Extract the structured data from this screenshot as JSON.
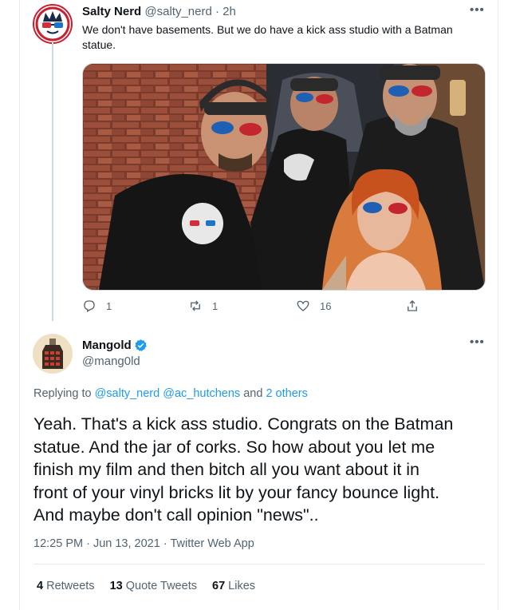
{
  "tweet1": {
    "display_name": "Salty Nerd",
    "handle": "@salty_nerd",
    "separator": "·",
    "time": "2h",
    "text_line1": "We don't have basements. But we do have a kick ass studio with a Batman",
    "text_line2": "statue.",
    "replies": "1",
    "retweets": "1",
    "likes": "16"
  },
  "tweet2": {
    "display_name": "Mangold",
    "handle": "@mang0ld",
    "replying_prefix": "Replying to",
    "replying_users": "@salty_nerd @ac_hutchens",
    "replying_and": "and",
    "replying_others": "2 others",
    "body_lines": [
      "Yeah. That's a kick ass studio. Congrats on the Batman",
      "statue. And the jar of corks. So how about you let me",
      "finish my film and then bitch all you want about it in",
      "front of your vinyl bricks lit by your fancy bounce light.",
      "And maybe don't call opinion \"news\".."
    ],
    "timestamp": "12:25 PM · Jun 13, 2021",
    "source_sep": "·",
    "source": "Twitter Web App",
    "stats": {
      "retweets_num": "4",
      "retweets_label": "Retweets",
      "quotes_num": "13",
      "quotes_label": "Quote Tweets",
      "likes_num": "67",
      "likes_label": "Likes"
    }
  },
  "more_icon": "•••",
  "colors": {
    "accent": "#1d9bf0",
    "muted": "#536471",
    "border": "#e6ecf0"
  }
}
